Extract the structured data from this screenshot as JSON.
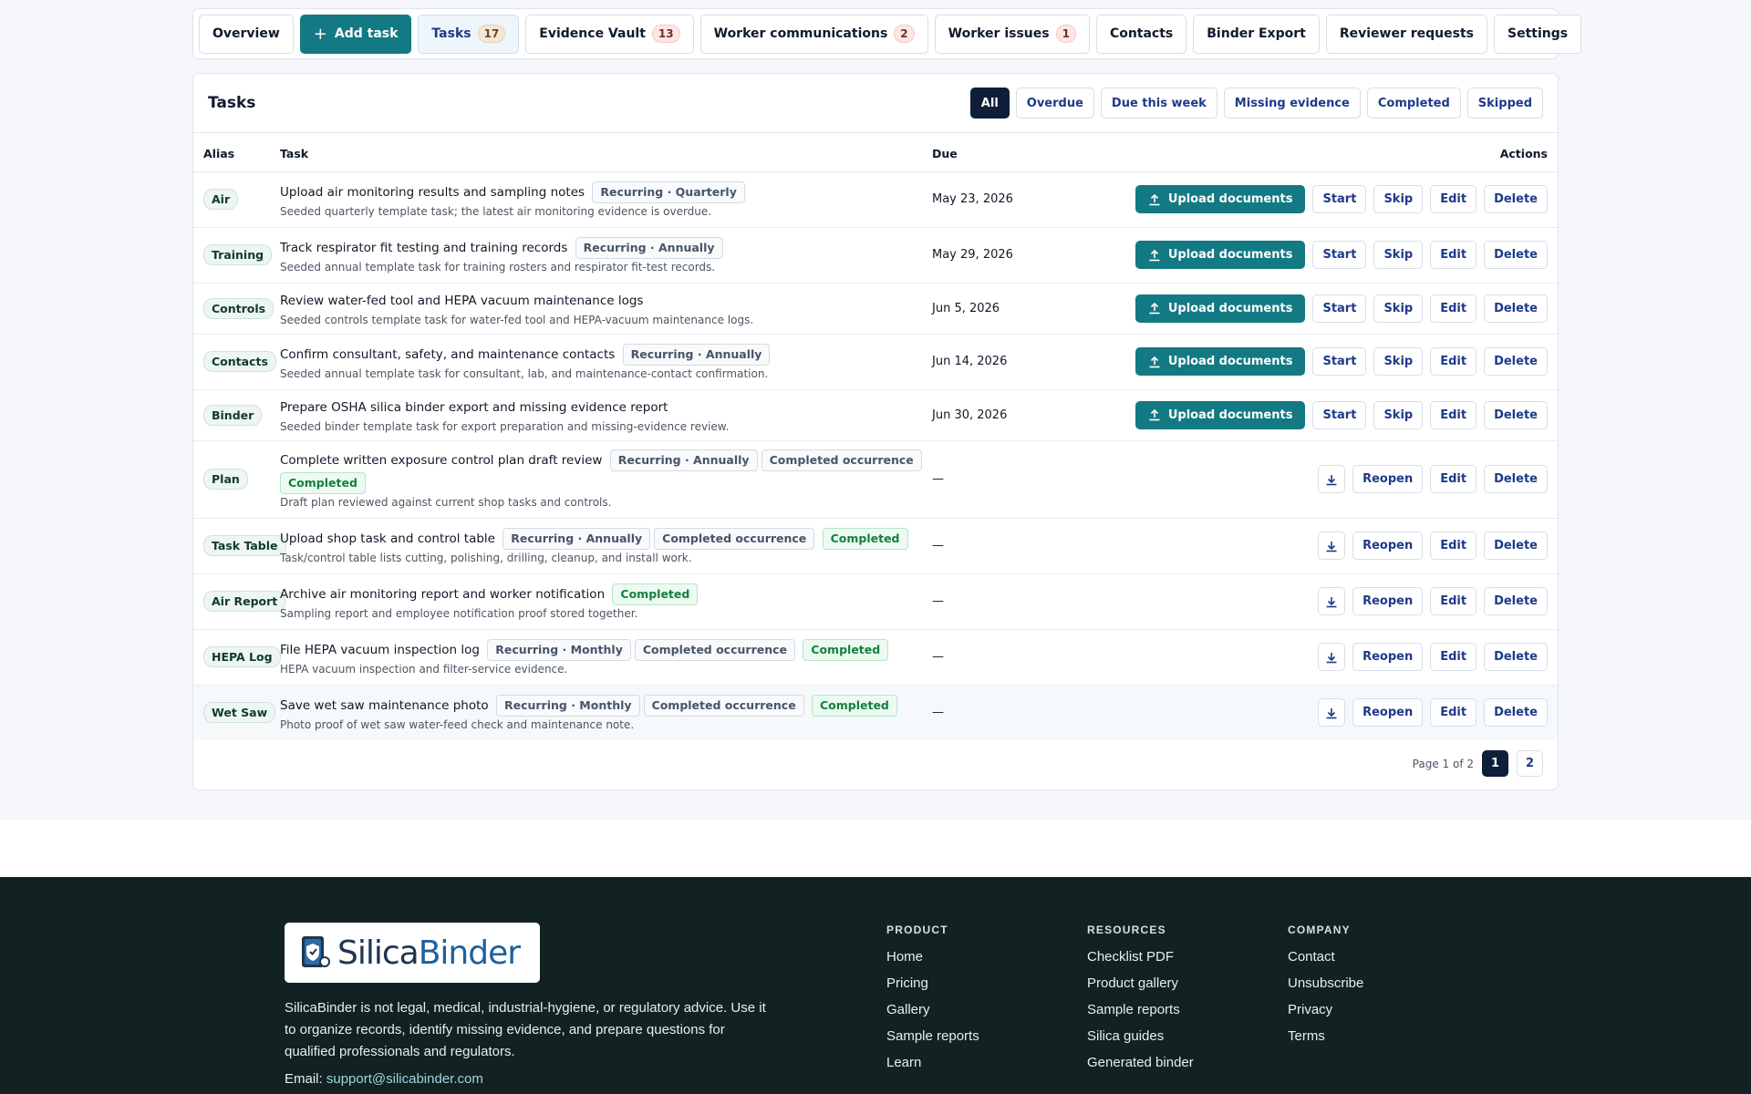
{
  "tabs": [
    {
      "label": "Overview"
    },
    {
      "label": "Add task"
    },
    {
      "label": "Tasks",
      "count": "17"
    },
    {
      "label": "Evidence Vault",
      "count": "13"
    },
    {
      "label": "Worker communications",
      "count": "2"
    },
    {
      "label": "Worker issues",
      "count": "1"
    },
    {
      "label": "Contacts"
    },
    {
      "label": "Binder Export"
    },
    {
      "label": "Reviewer requests"
    },
    {
      "label": "Settings"
    }
  ],
  "tasks_card": {
    "title": "Tasks",
    "filters": [
      "All",
      "Overdue",
      "Due this week",
      "Missing evidence",
      "Completed",
      "Skipped"
    ],
    "active_filter": "All",
    "columns": {
      "alias": "Alias",
      "task": "Task",
      "due": "Due",
      "actions": "Actions"
    },
    "action_labels": {
      "upload": "Upload documents",
      "start": "Start",
      "skip": "Skip",
      "edit": "Edit",
      "delete": "Delete",
      "reopen": "Reopen"
    },
    "rows": [
      {
        "alias": "Air",
        "title": "Upload air monitoring results and sampling notes",
        "tags": [
          "Recurring · Quarterly"
        ],
        "status": "",
        "desc": "Seeded quarterly template task; the latest air monitoring evidence is overdue.",
        "due": "May 23, 2026",
        "state": "open"
      },
      {
        "alias": "Training",
        "title": "Track respirator fit testing and training records",
        "tags": [
          "Recurring · Annually"
        ],
        "status": "",
        "desc": "Seeded annual template task for training rosters and respirator fit-test records.",
        "due": "May 29, 2026",
        "state": "open"
      },
      {
        "alias": "Controls",
        "title": "Review water-fed tool and HEPA vacuum maintenance logs",
        "tags": [],
        "status": "",
        "desc": "Seeded controls template task for water-fed tool and HEPA-vacuum maintenance logs.",
        "due": "Jun 5, 2026",
        "state": "open"
      },
      {
        "alias": "Contacts",
        "title": "Confirm consultant, safety, and maintenance contacts",
        "tags": [
          "Recurring · Annually"
        ],
        "status": "",
        "desc": "Seeded annual template task for consultant, lab, and maintenance-contact confirmation.",
        "due": "Jun 14, 2026",
        "state": "open"
      },
      {
        "alias": "Binder",
        "title": "Prepare OSHA silica binder export and missing evidence report",
        "tags": [],
        "status": "",
        "desc": "Seeded binder template task for export preparation and missing-evidence review.",
        "due": "Jun 30, 2026",
        "state": "open"
      },
      {
        "alias": "Plan",
        "title": "Complete written exposure control plan draft review",
        "tags": [
          "Recurring · Annually",
          "Completed occurrence"
        ],
        "status": "Completed",
        "desc": "Draft plan reviewed against current shop tasks and controls.",
        "due": "—",
        "state": "done"
      },
      {
        "alias": "Task Table",
        "title": "Upload shop task and control table",
        "tags": [
          "Recurring · Annually",
          "Completed occurrence"
        ],
        "status": "Completed",
        "desc": "Task/control table lists cutting, polishing, drilling, cleanup, and install work.",
        "due": "—",
        "state": "done"
      },
      {
        "alias": "Air Report",
        "title": "Archive air monitoring report and worker notification",
        "tags": [],
        "status": "Completed",
        "desc": "Sampling report and employee notification proof stored together.",
        "due": "—",
        "state": "done"
      },
      {
        "alias": "HEPA Log",
        "title": "File HEPA vacuum inspection log",
        "tags": [
          "Recurring · Monthly",
          "Completed occurrence"
        ],
        "status": "Completed",
        "desc": "HEPA vacuum inspection and filter-service evidence.",
        "due": "—",
        "state": "done"
      },
      {
        "alias": "Wet Saw",
        "title": "Save wet saw maintenance photo",
        "tags": [
          "Recurring · Monthly",
          "Completed occurrence"
        ],
        "status": "Completed",
        "desc": "Photo proof of wet saw water-feed check and maintenance note.",
        "due": "—",
        "state": "done"
      }
    ],
    "pagination": {
      "text": "Page 1 of 2",
      "pages": [
        "1",
        "2"
      ],
      "current": "1"
    }
  },
  "footer": {
    "logo_text_1": "Silica",
    "logo_text_2": "Binder",
    "disclaimer": "SilicaBinder is not legal, medical, industrial-hygiene, or regulatory advice. Use it to organize records, identify missing evidence, and prepare questions for qualified professionals and regulators.",
    "email_label": "Email:",
    "email": "support@silicabinder.com",
    "columns": [
      {
        "heading": "PRODUCT",
        "links": [
          "Home",
          "Pricing",
          "Gallery",
          "Sample reports",
          "Learn"
        ]
      },
      {
        "heading": "RESOURCES",
        "links": [
          "Checklist PDF",
          "Product gallery",
          "Sample reports",
          "Silica guides",
          "Generated binder"
        ]
      },
      {
        "heading": "COMPANY",
        "links": [
          "Contact",
          "Unsubscribe",
          "Privacy",
          "Terms"
        ]
      }
    ]
  },
  "colors": {
    "accent": "#137a83",
    "navy": "#0f1f3a",
    "footer_bg": "#122121",
    "completed_green": "#15803d"
  },
  "icons": {
    "add": "plus-icon",
    "upload": "upload-icon",
    "download": "download-icon",
    "logo": "binder-shield-icon"
  }
}
